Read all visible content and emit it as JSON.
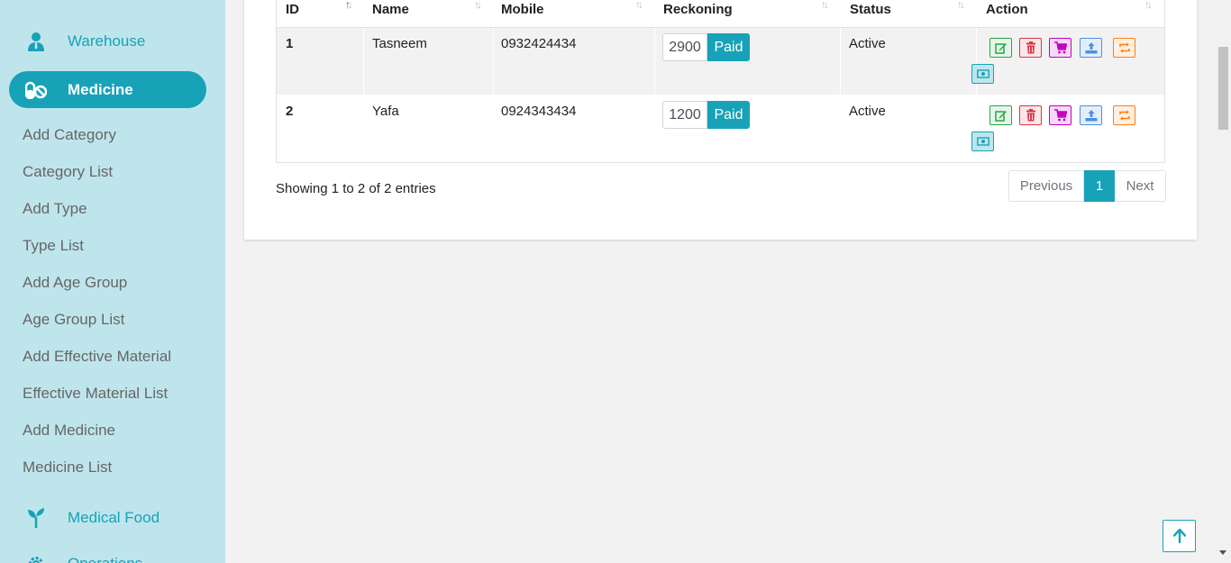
{
  "sidebar": {
    "warehouse": {
      "label": "Warehouse",
      "icon": "user-tie-icon"
    },
    "medicine": {
      "label": "Medicine",
      "icon": "pills-icon"
    },
    "submenu": [
      "Add Category",
      "Category List",
      "Add Type",
      "Type List",
      "Add Age Group",
      "Age Group List",
      "Add Effective Material",
      "Effective Material List",
      "Add Medicine",
      "Medicine List"
    ],
    "medical_food": {
      "label": "Medical Food",
      "icon": "seedling-icon"
    },
    "operations": {
      "label": "Operations",
      "icon": "gear-icon"
    }
  },
  "table": {
    "headers": [
      "ID",
      "Name",
      "Mobile",
      "Reckoning",
      "Status",
      "Action"
    ],
    "rows": [
      {
        "id": "1",
        "name": "Tasneem",
        "mobile": "0932424434",
        "amount": "2900",
        "paid_label": "Paid",
        "status": "Active"
      },
      {
        "id": "2",
        "name": "Yafa",
        "mobile": "0924343434",
        "amount": "1200",
        "paid_label": "Paid",
        "status": "Active"
      }
    ],
    "actions": [
      "edit-icon",
      "trash-icon",
      "cart-icon",
      "upload-icon",
      "retweet-icon",
      "money-icon"
    ]
  },
  "footer": {
    "info": "Showing 1 to 2 of 2 entries",
    "pagination": {
      "previous": "Previous",
      "page": "1",
      "next": "Next"
    }
  },
  "colors": {
    "accent": "#17a2b8",
    "sidebar_bg": "#bfe5ec",
    "page_bg": "#f2f2f2"
  }
}
